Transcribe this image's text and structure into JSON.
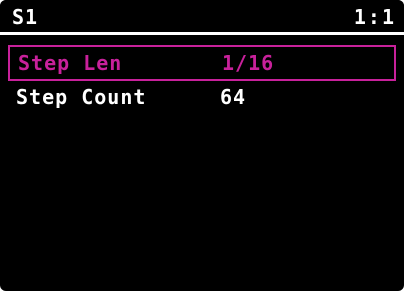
{
  "header": {
    "title": "S1",
    "position": "1:1"
  },
  "params": [
    {
      "label": "Step Len",
      "value": "1/16",
      "selected": true
    },
    {
      "label": "Step Count",
      "value": "64",
      "selected": false
    }
  ],
  "colors": {
    "background": "#000000",
    "text": "#ffffff",
    "accent": "#c8219b"
  }
}
